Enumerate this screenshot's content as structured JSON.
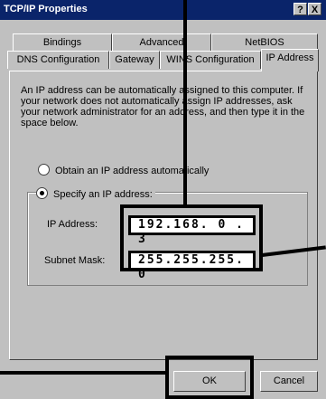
{
  "window": {
    "title": "TCP/IP Properties",
    "help_button": "?",
    "close_button": "X"
  },
  "tabs_back": [
    {
      "label": "Bindings"
    },
    {
      "label": "Advanced"
    },
    {
      "label": "NetBIOS"
    }
  ],
  "tabs_front": [
    {
      "label": "DNS Configuration"
    },
    {
      "label": "Gateway"
    },
    {
      "label": "WINS Configuration"
    },
    {
      "label": "IP Address",
      "active": true
    }
  ],
  "description": "An IP address can be automatically assigned to this computer. If your network does not automatically assign IP addresses, ask your network administrator for an address, and then type it in the space below.",
  "options": {
    "auto": {
      "label": "Obtain an IP address automatically",
      "selected": false
    },
    "specify": {
      "label": "Specify an IP address:",
      "selected": true
    }
  },
  "fields": {
    "ip_label": "IP Address:",
    "ip_value": "192.168. 0 . 3",
    "mask_label": "Subnet Mask:",
    "mask_value": "255.255.255. 0"
  },
  "buttons": {
    "ok": "OK",
    "cancel": "Cancel"
  },
  "colors": {
    "titlebar": "#0a246a",
    "face": "#c0c0c0",
    "callout": "#000000"
  }
}
